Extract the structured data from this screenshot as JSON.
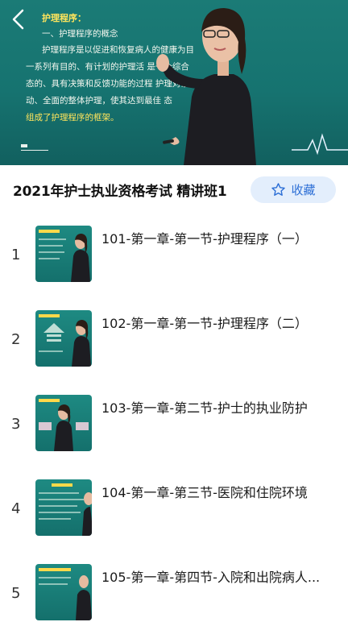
{
  "player": {
    "slide_heading": "护理程序：",
    "slide_lines": [
      "一、护理程序的概念",
      "护理程序是以促进和恢复病人的健康为目",
      "一系列有目的、有计划的护理活    是一个综合",
      "态的、具有决策和反馈功能的过程    护理对象",
      "动、全面的整体护理，使其达到最佳    态"
    ],
    "slide_highlight": "组成了护理程序的框架。"
  },
  "course": {
    "title": "2021年护士执业资格考试 精讲班1",
    "favorite_label": "收藏"
  },
  "episodes": [
    {
      "num": "1",
      "title": "101-第一章-第一节-护理程序（一）"
    },
    {
      "num": "2",
      "title": "102-第一章-第一节-护理程序（二）"
    },
    {
      "num": "3",
      "title": "103-第一章-第二节-护士的执业防护"
    },
    {
      "num": "4",
      "title": "104-第一章-第三节-医院和住院环境"
    },
    {
      "num": "5",
      "title": "105-第一章-第四节-入院和出院病人..."
    }
  ],
  "colors": {
    "player_bg": "#167370",
    "highlight_text": "#ffe55c",
    "favorite_bg": "#e3eefc",
    "favorite_text": "#2d6fd6"
  },
  "icons": {
    "back": "chevron-left-icon",
    "favorite": "star-outline-icon"
  }
}
